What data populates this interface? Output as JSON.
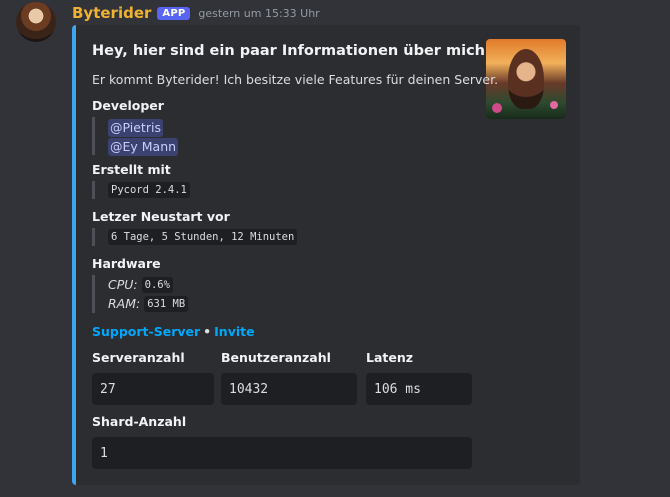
{
  "message": {
    "username": "Byterider",
    "badge": "APP",
    "timestamp": "gestern um 15:33 Uhr"
  },
  "embed": {
    "accent_color": "#3ea6ee",
    "title": "Hey, hier sind ein paar Informationen über mich",
    "description": "Er kommt Byterider! Ich besitze viele Features für deinen Server.",
    "developer": {
      "name": "Developer",
      "mentions": [
        "@Pietris",
        "@Ey Mann"
      ]
    },
    "created": {
      "name": "Erstellt mit",
      "value": "Pycord 2.4.1"
    },
    "restart": {
      "name": "Letzer Neustart vor",
      "value": "6 Tage, 5 Stunden, 12 Minuten"
    },
    "hardware": {
      "name": "Hardware",
      "cpu_label": "CPU:",
      "cpu_value": "0.6%",
      "ram_label": "RAM:",
      "ram_value": "631 MB"
    },
    "links": {
      "support": "Support-Server",
      "separator": "•",
      "invite": "Invite"
    },
    "stats": {
      "servers_label": "Serveranzahl",
      "servers_value": "27",
      "users_label": "Benutzeranzahl",
      "users_value": "10432",
      "latency_label": "Latenz",
      "latency_value": "106 ms",
      "shard_label": "Shard-Anzahl",
      "shard_value": "1"
    }
  }
}
